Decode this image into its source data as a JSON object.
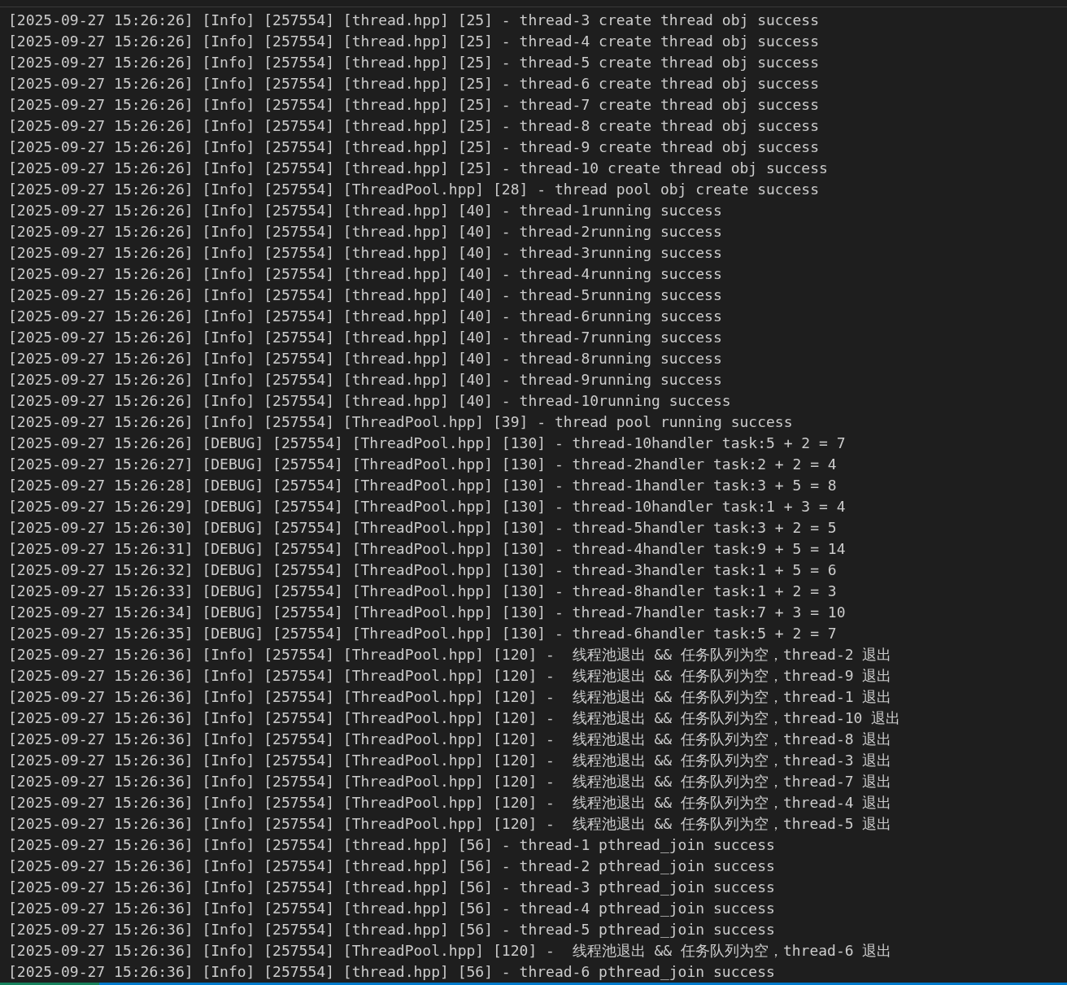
{
  "terminal": {
    "lines": [
      "[2025-09-27 15:26:26] [Info] [257554] [thread.hpp] [25] - thread-3 create thread obj success",
      "[2025-09-27 15:26:26] [Info] [257554] [thread.hpp] [25] - thread-4 create thread obj success",
      "[2025-09-27 15:26:26] [Info] [257554] [thread.hpp] [25] - thread-5 create thread obj success",
      "[2025-09-27 15:26:26] [Info] [257554] [thread.hpp] [25] - thread-6 create thread obj success",
      "[2025-09-27 15:26:26] [Info] [257554] [thread.hpp] [25] - thread-7 create thread obj success",
      "[2025-09-27 15:26:26] [Info] [257554] [thread.hpp] [25] - thread-8 create thread obj success",
      "[2025-09-27 15:26:26] [Info] [257554] [thread.hpp] [25] - thread-9 create thread obj success",
      "[2025-09-27 15:26:26] [Info] [257554] [thread.hpp] [25] - thread-10 create thread obj success",
      "[2025-09-27 15:26:26] [Info] [257554] [ThreadPool.hpp] [28] - thread pool obj create success",
      "[2025-09-27 15:26:26] [Info] [257554] [thread.hpp] [40] - thread-1running success",
      "[2025-09-27 15:26:26] [Info] [257554] [thread.hpp] [40] - thread-2running success",
      "[2025-09-27 15:26:26] [Info] [257554] [thread.hpp] [40] - thread-3running success",
      "[2025-09-27 15:26:26] [Info] [257554] [thread.hpp] [40] - thread-4running success",
      "[2025-09-27 15:26:26] [Info] [257554] [thread.hpp] [40] - thread-5running success",
      "[2025-09-27 15:26:26] [Info] [257554] [thread.hpp] [40] - thread-6running success",
      "[2025-09-27 15:26:26] [Info] [257554] [thread.hpp] [40] - thread-7running success",
      "[2025-09-27 15:26:26] [Info] [257554] [thread.hpp] [40] - thread-8running success",
      "[2025-09-27 15:26:26] [Info] [257554] [thread.hpp] [40] - thread-9running success",
      "[2025-09-27 15:26:26] [Info] [257554] [thread.hpp] [40] - thread-10running success",
      "[2025-09-27 15:26:26] [Info] [257554] [ThreadPool.hpp] [39] - thread pool running success",
      "[2025-09-27 15:26:26] [DEBUG] [257554] [ThreadPool.hpp] [130] - thread-10handler task:5 + 2 = 7",
      "[2025-09-27 15:26:27] [DEBUG] [257554] [ThreadPool.hpp] [130] - thread-2handler task:2 + 2 = 4",
      "[2025-09-27 15:26:28] [DEBUG] [257554] [ThreadPool.hpp] [130] - thread-1handler task:3 + 5 = 8",
      "[2025-09-27 15:26:29] [DEBUG] [257554] [ThreadPool.hpp] [130] - thread-10handler task:1 + 3 = 4",
      "[2025-09-27 15:26:30] [DEBUG] [257554] [ThreadPool.hpp] [130] - thread-5handler task:3 + 2 = 5",
      "[2025-09-27 15:26:31] [DEBUG] [257554] [ThreadPool.hpp] [130] - thread-4handler task:9 + 5 = 14",
      "[2025-09-27 15:26:32] [DEBUG] [257554] [ThreadPool.hpp] [130] - thread-3handler task:1 + 5 = 6",
      "[2025-09-27 15:26:33] [DEBUG] [257554] [ThreadPool.hpp] [130] - thread-8handler task:1 + 2 = 3",
      "[2025-09-27 15:26:34] [DEBUG] [257554] [ThreadPool.hpp] [130] - thread-7handler task:7 + 3 = 10",
      "[2025-09-27 15:26:35] [DEBUG] [257554] [ThreadPool.hpp] [130] - thread-6handler task:5 + 2 = 7",
      "[2025-09-27 15:26:36] [Info] [257554] [ThreadPool.hpp] [120] -  线程池退出 && 任务队列为空，thread-2 退出",
      "[2025-09-27 15:26:36] [Info] [257554] [ThreadPool.hpp] [120] -  线程池退出 && 任务队列为空，thread-9 退出",
      "[2025-09-27 15:26:36] [Info] [257554] [ThreadPool.hpp] [120] -  线程池退出 && 任务队列为空，thread-1 退出",
      "[2025-09-27 15:26:36] [Info] [257554] [ThreadPool.hpp] [120] -  线程池退出 && 任务队列为空，thread-10 退出",
      "[2025-09-27 15:26:36] [Info] [257554] [ThreadPool.hpp] [120] -  线程池退出 && 任务队列为空，thread-8 退出",
      "[2025-09-27 15:26:36] [Info] [257554] [ThreadPool.hpp] [120] -  线程池退出 && 任务队列为空，thread-3 退出",
      "[2025-09-27 15:26:36] [Info] [257554] [ThreadPool.hpp] [120] -  线程池退出 && 任务队列为空，thread-7 退出",
      "[2025-09-27 15:26:36] [Info] [257554] [ThreadPool.hpp] [120] -  线程池退出 && 任务队列为空，thread-4 退出",
      "[2025-09-27 15:26:36] [Info] [257554] [ThreadPool.hpp] [120] -  线程池退出 && 任务队列为空，thread-5 退出",
      "[2025-09-27 15:26:36] [Info] [257554] [thread.hpp] [56] - thread-1 pthread_join success",
      "[2025-09-27 15:26:36] [Info] [257554] [thread.hpp] [56] - thread-2 pthread_join success",
      "[2025-09-27 15:26:36] [Info] [257554] [thread.hpp] [56] - thread-3 pthread_join success",
      "[2025-09-27 15:26:36] [Info] [257554] [thread.hpp] [56] - thread-4 pthread_join success",
      "[2025-09-27 15:26:36] [Info] [257554] [thread.hpp] [56] - thread-5 pthread_join success",
      "[2025-09-27 15:26:36] [Info] [257554] [ThreadPool.hpp] [120] -  线程池退出 && 任务队列为空，thread-6 退出",
      "[2025-09-27 15:26:36] [Info] [257554] [thread.hpp] [56] - thread-6 pthread_join success"
    ]
  }
}
